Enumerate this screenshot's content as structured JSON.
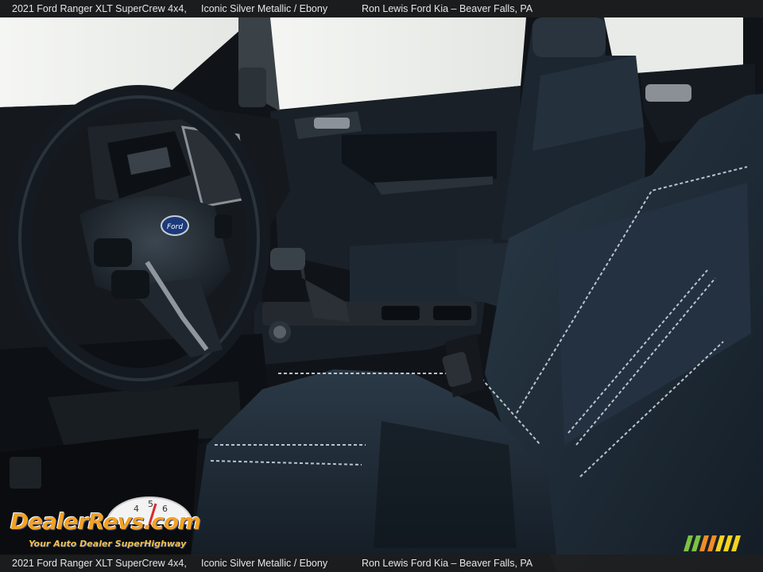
{
  "caption": {
    "model": "2021 Ford Ranger XLT SuperCrew 4x4,",
    "color": "Iconic Silver Metallic / Ebony",
    "dealer": "Ron Lewis Ford Kia – Beaver Falls, PA"
  },
  "watermark": {
    "logo_text": "DealerRevs.com",
    "tagline": "Your Auto Dealer SuperHighway",
    "gauge_digits": [
      "4",
      "5",
      "6"
    ]
  },
  "colors": {
    "upholstery": "#1d2833",
    "stitching": "#b9c4cc",
    "window_glare": "#f2f4f2",
    "logo_orange": "#f2a225",
    "logo_blue": "#2a3f7a"
  }
}
